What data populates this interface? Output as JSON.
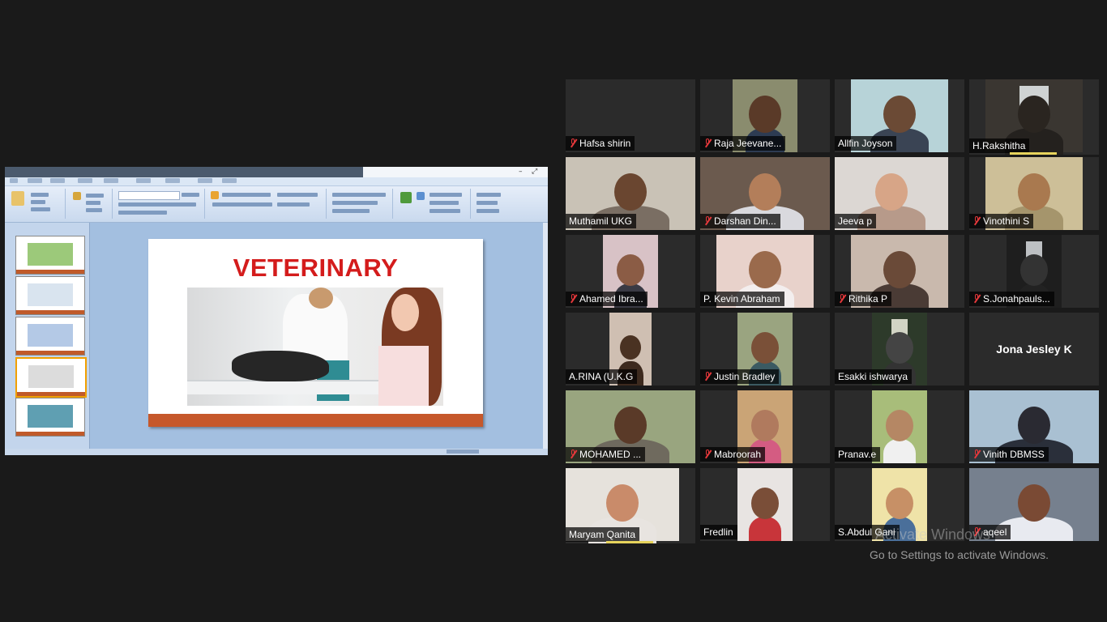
{
  "share": {
    "app": "PowerPoint",
    "slide_title": "VETERINARY",
    "thumb_count": 5,
    "selected_thumb": 4
  },
  "participants": [
    {
      "name": "Hafsa shirin",
      "muted": true,
      "video": "none"
    },
    {
      "name": "Raja Jeevane...",
      "muted": true,
      "video": "man-indoor"
    },
    {
      "name": "Allfin Joyson",
      "muted": false,
      "video": "boy-window"
    },
    {
      "name": "H.Rakshitha",
      "muted": false,
      "video": "dark-window",
      "speaking": true
    },
    {
      "name": "Muthamil UKG",
      "muted": false,
      "video": "woman-shelves",
      "active_speaker": true
    },
    {
      "name": "Darshan Din...",
      "muted": true,
      "video": "two-boys"
    },
    {
      "name": "Jeeva p",
      "muted": false,
      "video": "boy-closeup"
    },
    {
      "name": "Vinothini S",
      "muted": true,
      "video": "girl-uniform"
    },
    {
      "name": "Ahamed Ibra...",
      "muted": true,
      "video": "boys-pink-room"
    },
    {
      "name": "P. Kevin Abraham",
      "muted": false,
      "video": "boy-white-cap"
    },
    {
      "name": "Rithika P",
      "muted": true,
      "video": "child-room"
    },
    {
      "name": "S.Jonahpauls...",
      "muted": true,
      "video": "dark-room"
    },
    {
      "name": "A.RINA (U.K.G",
      "muted": false,
      "video": "child-bottom"
    },
    {
      "name": "Justin Bradley",
      "muted": true,
      "video": "two-kids"
    },
    {
      "name": "Esakki ishwarya",
      "muted": false,
      "video": "dim-room"
    },
    {
      "name": "Jona Jesley K",
      "muted": false,
      "video": "off"
    },
    {
      "name": "MOHAMED ...",
      "muted": true,
      "video": "boy-thinking"
    },
    {
      "name": "Mabroorah",
      "muted": true,
      "video": "kids-pink"
    },
    {
      "name": "Pranav.e",
      "muted": false,
      "video": "boy-green"
    },
    {
      "name": "Vinith DBMSS",
      "muted": true,
      "video": "blurry-boy"
    },
    {
      "name": "Maryam Qanita",
      "muted": false,
      "video": "girl-curly",
      "speaking": true
    },
    {
      "name": "Fredlin",
      "muted": false,
      "video": "boy-closeup-2"
    },
    {
      "name": "S.Abdul Gani",
      "muted": false,
      "video": "boy-yellow"
    },
    {
      "name": "aqeel",
      "muted": true,
      "video": "boy-sunset"
    }
  ],
  "watermark": {
    "title": "Activate Windows",
    "subtitle": "Go to Settings to activate Windows."
  }
}
